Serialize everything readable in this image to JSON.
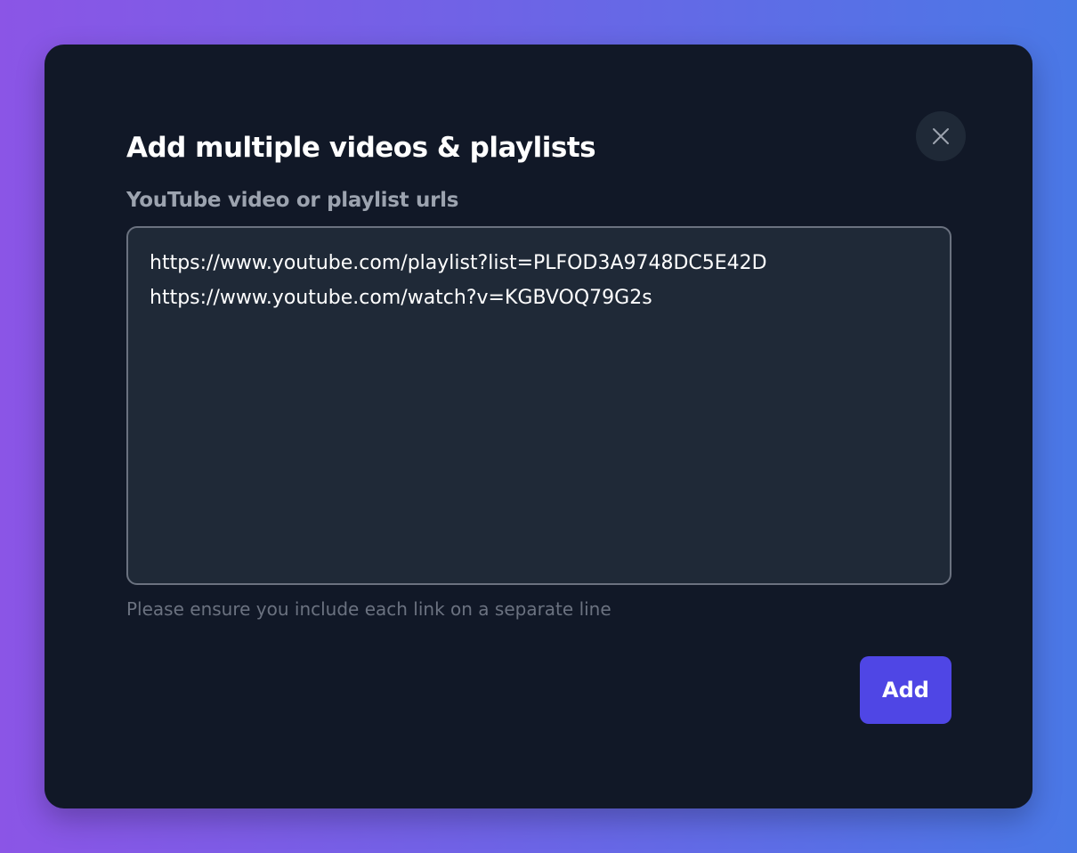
{
  "modal": {
    "title": "Add multiple videos & playlists",
    "field_label": "YouTube video or playlist urls",
    "urls_value": "https://www.youtube.com/playlist?list=PLFOD3A9748DC5E42D\nhttps://www.youtube.com/watch?v=KGBVOQ79G2s",
    "helper_text": "Please ensure you include each link on a separate line",
    "add_label": "Add",
    "close_icon": "close-icon"
  },
  "colors": {
    "modal_bg": "#111827",
    "input_bg": "#1f2937",
    "accent": "#4f46e5",
    "label": "#9ca3af",
    "helper": "#6b7280"
  }
}
